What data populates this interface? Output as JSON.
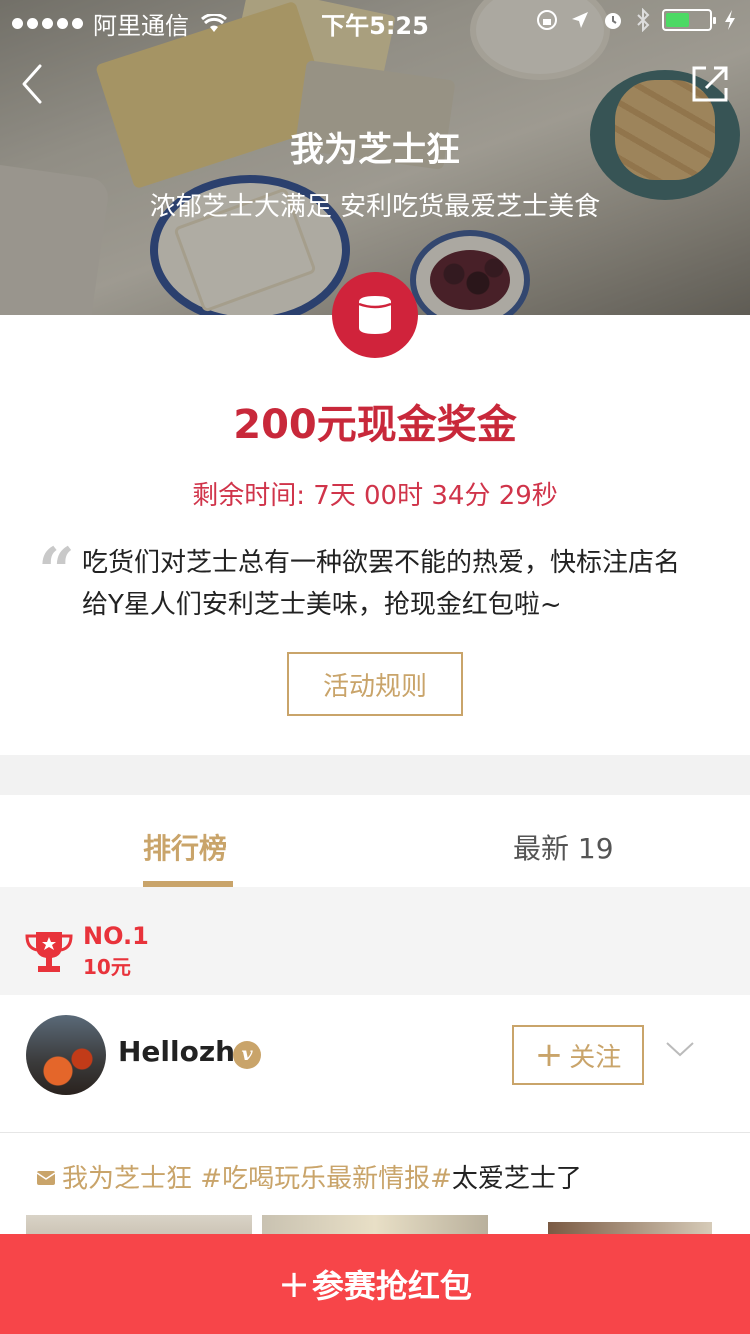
{
  "status_bar": {
    "carrier": "阿里通信",
    "time": "下午5:25",
    "battery_level": 0.55
  },
  "header": {
    "title": "我为芝士狂",
    "subtitle": "浓郁芝士大满足 安利吃货最爱芝士美食"
  },
  "prize": {
    "amount_label": "200元现金奖金",
    "countdown": "剩余时间: 7天 00时 34分 29秒"
  },
  "description": "吃货们对芝士总有一种欲罢不能的热爱，快标注店名给Y星人们安利芝士美味，抢现金红包啦~",
  "rules_button": "活动规则",
  "tabs": {
    "ranking": "排行榜",
    "latest": "最新 19"
  },
  "rank": {
    "position": "NO.1",
    "reward": "10元"
  },
  "user": {
    "name": "Hellozh",
    "verified_badge": "v",
    "follow_label": "关注",
    "follow_plus": "+"
  },
  "post": {
    "topic_1": "我为芝士狂",
    "topic_2": "#吃喝玩乐最新情报#",
    "body": "太爱芝士了"
  },
  "join_button": {
    "plus": "+",
    "label": "参赛抢红包"
  },
  "colors": {
    "accent_gold": "#c9a46a",
    "prize_red": "#c8283a",
    "join_red": "#f74549",
    "badge_red": "#d0233b"
  },
  "icons": [
    "back-icon",
    "share-icon",
    "cup-icon",
    "trophy-icon",
    "chevron-down-icon",
    "mail-icon",
    "wifi-icon",
    "battery-icon"
  ]
}
